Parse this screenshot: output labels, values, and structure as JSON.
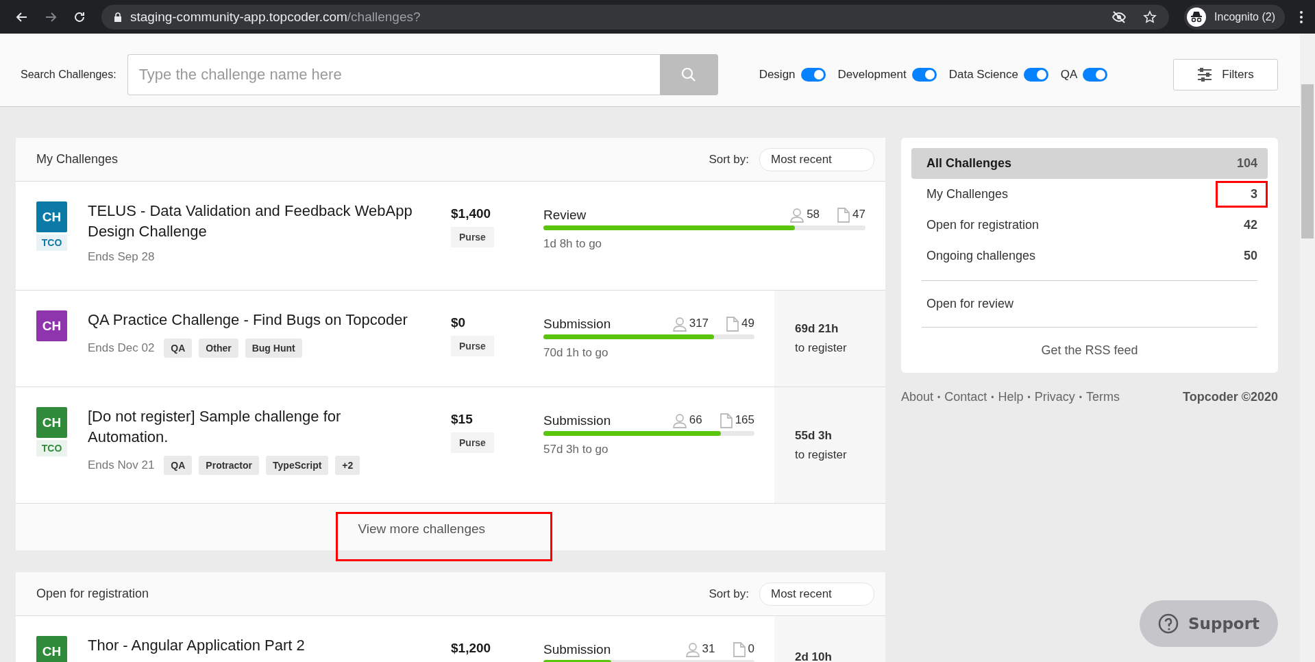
{
  "browser": {
    "url_host": "staging-community-app.topcoder.com",
    "url_path": "/challenges?",
    "profile": "Incognito (2)"
  },
  "search": {
    "label": "Search Challenges:",
    "placeholder": "Type the challenge name here"
  },
  "tracks": [
    {
      "label": "Design",
      "on": true
    },
    {
      "label": "Development",
      "on": true
    },
    {
      "label": "Data Science",
      "on": true
    },
    {
      "label": "QA",
      "on": true
    }
  ],
  "filters_button": "Filters",
  "sections": [
    {
      "title": "My Challenges",
      "sort_label": "Sort by:",
      "sort_value": "Most recent",
      "more": {
        "label": "View more challenges",
        "highlighted": true
      },
      "challenges": [
        {
          "avatar": "CH",
          "color": "#0c7aa6",
          "badge": {
            "label": "TCO",
            "color": "#0c7aa6"
          },
          "title": "TELUS - Data Validation and Feedback WebApp Design Challenge",
          "ends": "Ends Sep 28",
          "prize": "$1,400",
          "prize_label": "Purse",
          "phase": "Review",
          "level": 0.78,
          "time_left": "1d 8h to go",
          "registrants": "58",
          "submissions": "47"
        },
        {
          "avatar": "CH",
          "color": "#8e35ad",
          "title": "QA Practice Challenge - Find Bugs on Topcoder",
          "ends": "Ends Dec 02",
          "tags": [
            "QA",
            "Other",
            "Bug Hunt"
          ],
          "prize": "$0",
          "prize_label": "Purse",
          "phase": "Submission",
          "level": 0.81,
          "time_left": "70d 1h to go",
          "registrants": "317",
          "submissions": "49",
          "register_time": "69d 21h",
          "register_label": "to register"
        },
        {
          "avatar": "CH",
          "color": "#2f8a3a",
          "badge": {
            "label": "TCO",
            "color": "#2f8a3a"
          },
          "title": "[Do not register] Sample challenge for Automation.",
          "ends": "Ends Nov 21",
          "tags": [
            "QA",
            "Protractor",
            "TypeScript",
            "+2"
          ],
          "prize": "$15",
          "prize_label": "Purse",
          "phase": "Submission",
          "level": 0.84,
          "time_left": "57d 3h to go",
          "registrants": "66",
          "submissions": "165",
          "register_time": "55d 3h",
          "register_label": "to register"
        }
      ]
    },
    {
      "title": "Open for registration",
      "sort_label": "Sort by:",
      "sort_value": "Most recent",
      "challenges": [
        {
          "avatar": "CH",
          "color": "#2f8a3a",
          "title": "Thor - Angular Application Part 2",
          "prize": "$1,200",
          "phase": "Submission",
          "level": 0.32,
          "registrants": "31",
          "submissions": "0",
          "register_time": "2d 10h"
        }
      ]
    }
  ],
  "sidebar": {
    "items": [
      {
        "label": "All Challenges",
        "count": "104",
        "selected": true,
        "highlighted": false
      },
      {
        "label": "My Challenges",
        "count": "3",
        "selected": false,
        "highlighted": true
      },
      {
        "label": "Open for registration",
        "count": "42",
        "selected": false,
        "highlighted": false
      },
      {
        "label": "Ongoing challenges",
        "count": "50",
        "selected": false,
        "highlighted": false
      }
    ],
    "review_link": "Open for review",
    "rss_link": "Get the RSS feed"
  },
  "footer": {
    "separator": "•",
    "links": [
      "About",
      "Contact",
      "Help",
      "Privacy",
      "Terms"
    ],
    "copyright": "Topcoder ©2020"
  },
  "support_button": "Support"
}
